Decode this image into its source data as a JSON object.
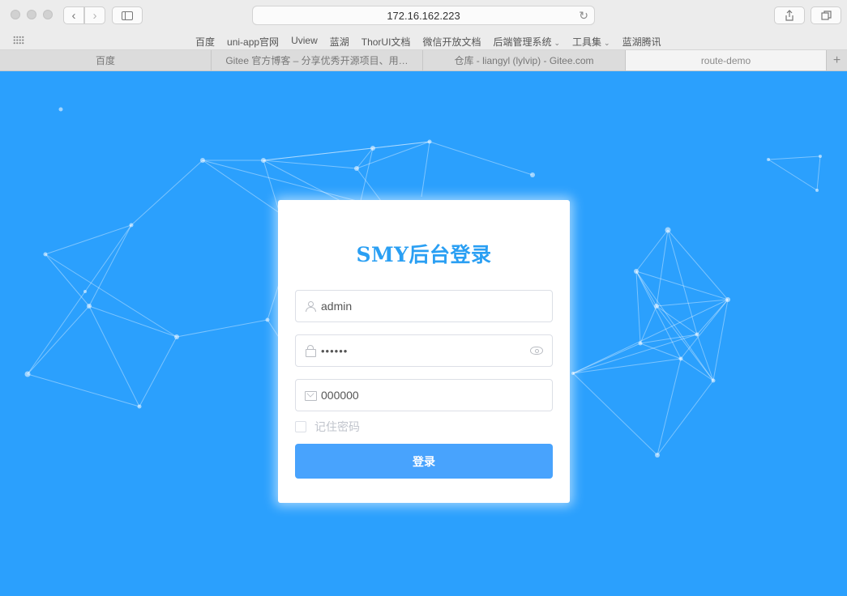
{
  "browser": {
    "url": "172.16.162.223",
    "bookmarks": [
      {
        "label": "百度",
        "dropdown": false
      },
      {
        "label": "uni-app官网",
        "dropdown": false
      },
      {
        "label": "Uview",
        "dropdown": false
      },
      {
        "label": "蓝湖",
        "dropdown": false
      },
      {
        "label": "ThorUI文档",
        "dropdown": false
      },
      {
        "label": "微信开放文档",
        "dropdown": false
      },
      {
        "label": "后端管理系统",
        "dropdown": true
      },
      {
        "label": "工具集",
        "dropdown": true
      },
      {
        "label": "蓝湖腾讯",
        "dropdown": false
      }
    ],
    "tabs": [
      {
        "label": "百度",
        "active": false
      },
      {
        "label": "Gitee 官方博客 – 分享优秀开源项目、用…",
        "active": false
      },
      {
        "label": "仓库 - liangyl (lylvip) - Gitee.com",
        "active": false
      },
      {
        "label": "route-demo",
        "active": true
      }
    ],
    "icons": {
      "back": "‹",
      "forward": "›",
      "reload": "↻",
      "add_tab": "+"
    }
  },
  "login": {
    "title": "SMY后台登录",
    "username_value": "admin",
    "password_value": "••••••",
    "code_value": "000000",
    "remember_label": "记住密码",
    "remember_checked": false,
    "submit_label": "登录"
  },
  "colors": {
    "background": "#2ba0fd",
    "title": "#2a9ff3",
    "button": "#48a3fd"
  }
}
